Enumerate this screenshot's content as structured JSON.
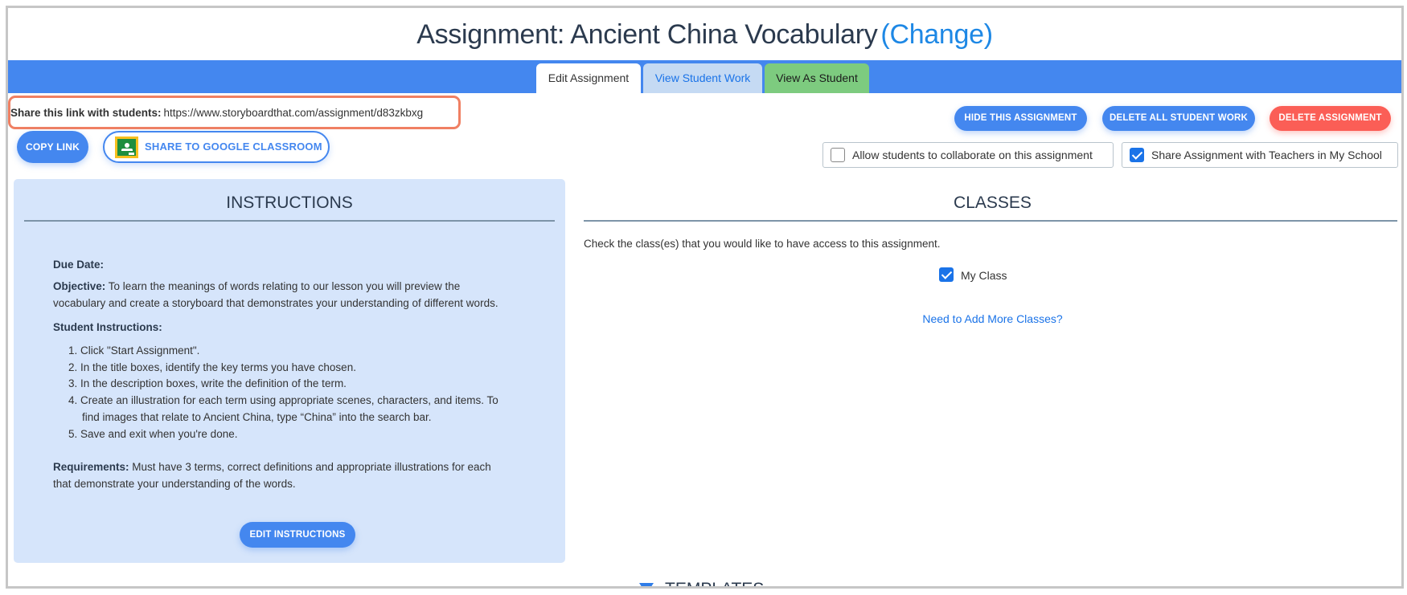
{
  "header": {
    "title": "Assignment: Ancient China Vocabulary",
    "change_link": "(Change)"
  },
  "tabs": [
    {
      "label": "Edit Assignment",
      "active": true
    },
    {
      "label": "View Student Work",
      "active": false
    },
    {
      "label": "View As Student",
      "active": false
    }
  ],
  "share": {
    "label": "Share this link with students:",
    "url": "https://www.storyboardthat.com/assignment/d83zkbxg",
    "copy_button": "COPY LINK",
    "google_classroom_button": "SHARE TO GOOGLE CLASSROOM"
  },
  "actions": {
    "hide": "HIDE THIS ASSIGNMENT",
    "delete_all_work": "DELETE ALL STUDENT WORK",
    "delete_assignment": "DELETE ASSIGNMENT"
  },
  "options": {
    "collaborate": {
      "label": "Allow students to collaborate on this assignment",
      "checked": false
    },
    "share_teachers": {
      "label": "Share Assignment with Teachers in My School",
      "checked": true
    }
  },
  "instructions": {
    "heading": "INSTRUCTIONS",
    "due_date_label": "Due Date:",
    "objective_label": "Objective:",
    "objective_line1": "To learn the meanings of words relating to our lesson you will preview the",
    "objective_line2": "vocabulary and create a storyboard that demonstrates your understanding of different words.",
    "student_instructions_label": "Student Instructions:",
    "steps": [
      "1. Click \"Start Assignment\".",
      "2. In the title boxes, identify the key terms you have chosen.",
      "3. In the description boxes, write the definition of the term.",
      "4. Create an illustration for each term using appropriate scenes, characters, and items. To",
      "find images that relate to Ancient China, type “China” into the search bar.",
      "5. Save and exit when you're done."
    ],
    "requirements_label": "Requirements:",
    "requirements_line1": "Must have 3 terms, correct definitions and appropriate illustrations for each",
    "requirements_line2": "that demonstrate your understanding of the words.",
    "edit_button": "EDIT INSTRUCTIONS"
  },
  "classes": {
    "heading": "CLASSES",
    "prompt": "Check the class(es) that you would like to have access to this assignment.",
    "items": [
      {
        "label": "My Class",
        "checked": true
      }
    ],
    "add_more_link": "Need to Add More Classes?"
  },
  "templates": {
    "heading": "TEMPLATES"
  },
  "colors": {
    "primary_blue": "#4487ef",
    "danger_red": "#fb5e56",
    "tab_green": "#7dcb7f",
    "tab_light_blue": "#c5daf3",
    "panel_bg": "#d6e5fb",
    "highlight_orange": "#f08063",
    "link_blue": "#1a73e8"
  }
}
